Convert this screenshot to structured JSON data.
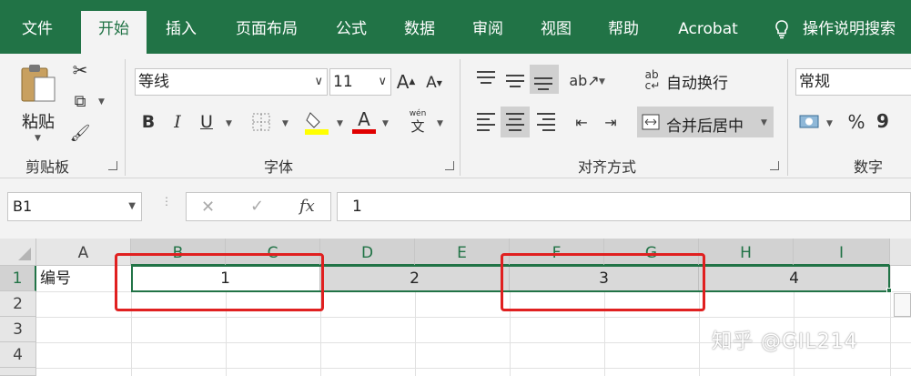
{
  "tabs": [
    "文件",
    "开始",
    "插入",
    "页面布局",
    "公式",
    "数据",
    "审阅",
    "视图",
    "帮助",
    "Acrobat"
  ],
  "tell_me": "操作说明搜索",
  "clipboard": {
    "paste_label": "粘贴",
    "group_label": "剪贴板"
  },
  "font": {
    "name": "等线",
    "size": "11",
    "group_label": "字体",
    "bold": "B",
    "italic": "I",
    "underline": "U",
    "grow": "A",
    "shrink": "A",
    "color_letter": "A",
    "phonetic_top": "wén",
    "phonetic_bottom": "文",
    "highlight_color": "#ffff00",
    "font_color": "#e00000"
  },
  "alignment": {
    "wrap_text": "自动换行",
    "merge_center": "合并后居中",
    "group_label": "对齐方式"
  },
  "number": {
    "format": "常规",
    "group_label": "数字",
    "percent": "%",
    "comma": "9"
  },
  "formula_bar": {
    "name_box": "B1",
    "fx": "fx",
    "cancel": "✕",
    "enter": "✓",
    "content": "1"
  },
  "sheet": {
    "columns": [
      "A",
      "B",
      "C",
      "D",
      "E",
      "F",
      "G",
      "H",
      "I"
    ],
    "rows": [
      "1",
      "2",
      "3",
      "4"
    ],
    "a1": "编号",
    "merged_values": [
      "1",
      "2",
      "3",
      "4"
    ]
  },
  "watermark": "知乎 @GIL214",
  "colors": {
    "accent": "#217346",
    "highlight_box": "#e02020"
  }
}
